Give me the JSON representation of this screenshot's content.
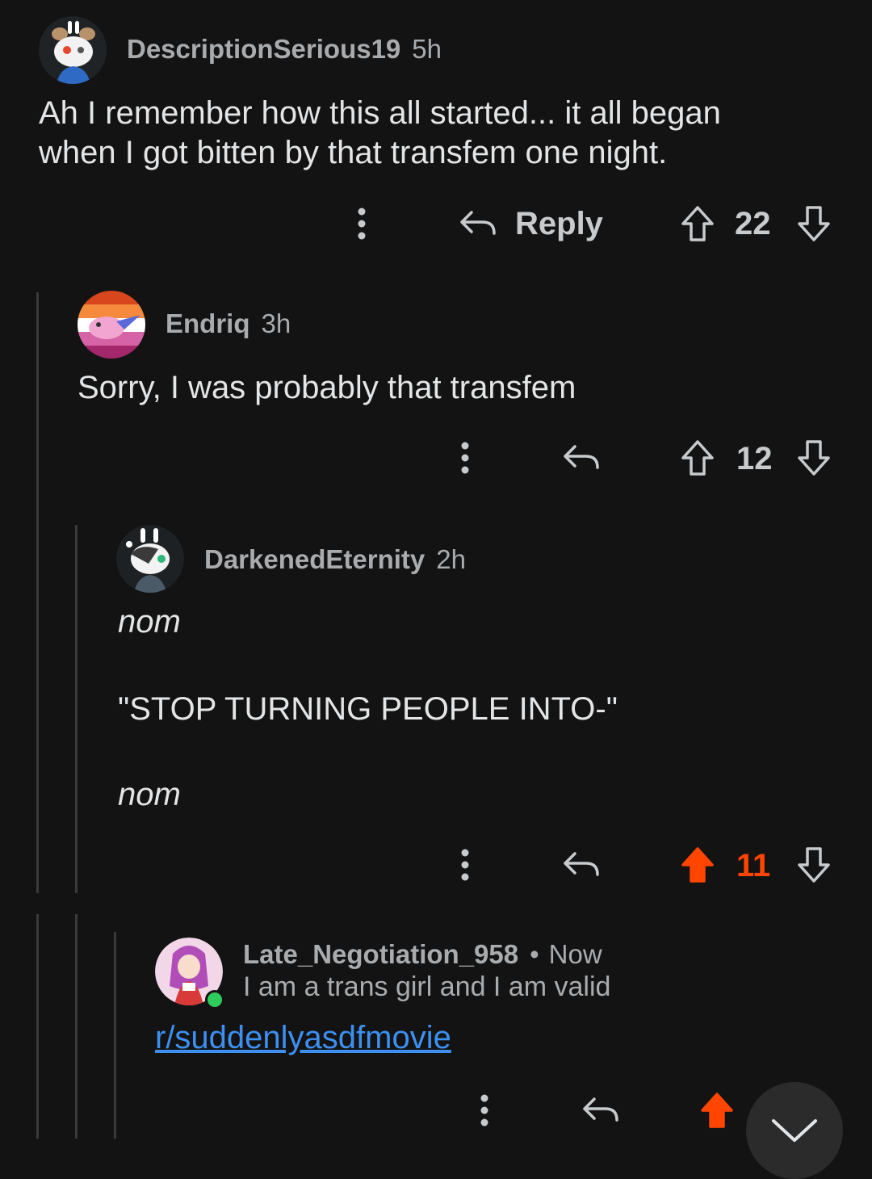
{
  "comments": [
    {
      "username": "DescriptionSerious19",
      "time": "5h",
      "body": [
        "Ah I remember how this all started... it all began",
        "when I got bitten by that transfem one night."
      ],
      "reply_label": "Reply",
      "score": "22",
      "vote_state": "none"
    },
    {
      "username": "Endriq",
      "time": "3h",
      "body": [
        "Sorry, I was probably that transfem"
      ],
      "score": "12",
      "vote_state": "none"
    },
    {
      "username": "DarkenedEternity",
      "time": "2h",
      "body": [
        "nom",
        "\"STOP TURNING PEOPLE INTO-\"",
        "nom"
      ],
      "score": "11",
      "vote_state": "upvoted"
    },
    {
      "username": "Late_Negotiation_958",
      "separator": "•",
      "time": "Now",
      "flair": "I am a trans girl and I am valid",
      "link": "r/suddenlyasdfmovie",
      "vote_state": "upvoted",
      "online": true
    }
  ],
  "colors": {
    "background": "#131313",
    "upvote": "#ff4500",
    "link": "#3d8ff0",
    "online": "#2ecc5b"
  },
  "icons": [
    "more-vertical-icon",
    "reply-arrow-icon",
    "upvote-arrow-icon",
    "downvote-arrow-icon",
    "chevron-down-icon"
  ]
}
